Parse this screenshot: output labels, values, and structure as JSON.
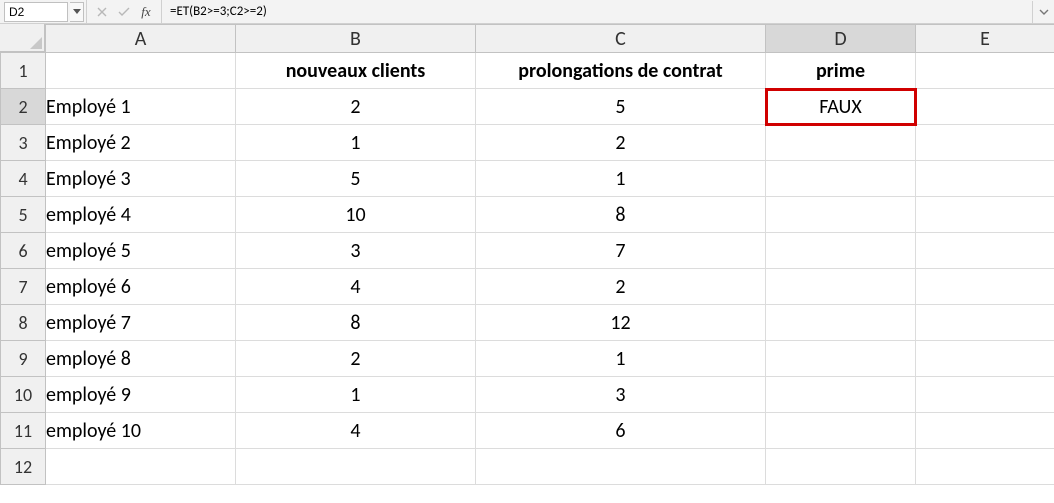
{
  "formula_bar": {
    "cell_ref": "D2",
    "fx_label": "fx",
    "formula": "=ET(B2>=3;C2>=2)"
  },
  "column_headers": [
    "A",
    "B",
    "C",
    "D",
    "E"
  ],
  "row_headers": [
    "1",
    "2",
    "3",
    "4",
    "5",
    "6",
    "7",
    "8",
    "9",
    "10",
    "11",
    "12"
  ],
  "header_row": {
    "A": "",
    "B": "nouveaux clients",
    "C": "prolongations de contrat",
    "D": "prime",
    "E": ""
  },
  "data_rows": [
    {
      "A": "Employé 1",
      "B": "2",
      "C": "5",
      "D": "FAUX",
      "E": ""
    },
    {
      "A": "Employé 2",
      "B": "1",
      "C": "2",
      "D": "",
      "E": ""
    },
    {
      "A": "Employé 3",
      "B": "5",
      "C": "1",
      "D": "",
      "E": ""
    },
    {
      "A": "employé 4",
      "B": "10",
      "C": "8",
      "D": "",
      "E": ""
    },
    {
      "A": "employé 5",
      "B": "3",
      "C": "7",
      "D": "",
      "E": ""
    },
    {
      "A": "employé 6",
      "B": "4",
      "C": "2",
      "D": "",
      "E": ""
    },
    {
      "A": "employé 7",
      "B": "8",
      "C": "12",
      "D": "",
      "E": ""
    },
    {
      "A": "employé 8",
      "B": "2",
      "C": "1",
      "D": "",
      "E": ""
    },
    {
      "A": "employé 9",
      "B": "1",
      "C": "3",
      "D": "",
      "E": ""
    },
    {
      "A": "employé 10",
      "B": "4",
      "C": "6",
      "D": "",
      "E": ""
    }
  ],
  "selected_cell": {
    "row": 2,
    "col": "D"
  },
  "chart_data": {
    "type": "table",
    "columns": [
      "nouveaux clients",
      "prolongations de contrat",
      "prime"
    ],
    "rows": [
      {
        "label": "Employé 1",
        "nouveaux clients": 2,
        "prolongations de contrat": 5,
        "prime": "FAUX"
      },
      {
        "label": "Employé 2",
        "nouveaux clients": 1,
        "prolongations de contrat": 2,
        "prime": null
      },
      {
        "label": "Employé 3",
        "nouveaux clients": 5,
        "prolongations de contrat": 1,
        "prime": null
      },
      {
        "label": "employé 4",
        "nouveaux clients": 10,
        "prolongations de contrat": 8,
        "prime": null
      },
      {
        "label": "employé 5",
        "nouveaux clients": 3,
        "prolongations de contrat": 7,
        "prime": null
      },
      {
        "label": "employé 6",
        "nouveaux clients": 4,
        "prolongations de contrat": 2,
        "prime": null
      },
      {
        "label": "employé 7",
        "nouveaux clients": 8,
        "prolongations de contrat": 12,
        "prime": null
      },
      {
        "label": "employé 8",
        "nouveaux clients": 2,
        "prolongations de contrat": 1,
        "prime": null
      },
      {
        "label": "employé 9",
        "nouveaux clients": 1,
        "prolongations de contrat": 3,
        "prime": null
      },
      {
        "label": "employé 10",
        "nouveaux clients": 4,
        "prolongations de contrat": 6,
        "prime": null
      }
    ]
  }
}
